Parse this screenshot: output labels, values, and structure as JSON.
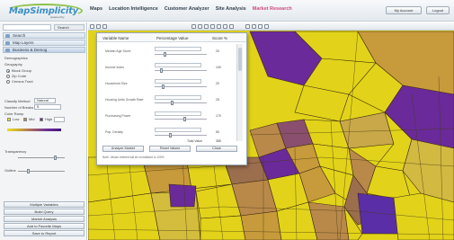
{
  "app": {
    "logo_text": "MapSimplicity",
    "logo_sub": "powered by"
  },
  "top_menu": [
    {
      "label": "Maps"
    },
    {
      "label": "Location Intelligence"
    },
    {
      "label": "Customer Analyzer"
    },
    {
      "label": "Site Analysis"
    },
    {
      "label": "Market Research",
      "active": true
    }
  ],
  "header_buttons": [
    {
      "label": "My Account"
    },
    {
      "label": "Logout"
    }
  ],
  "sidebar": {
    "search_button": "Search",
    "tabs": [
      {
        "label": "Search"
      },
      {
        "label": "Map Layers"
      },
      {
        "label": "Business & Demog"
      }
    ],
    "section_label": "Demographics",
    "geography_label": "Geography",
    "radio_options": [
      {
        "label": "Block Group",
        "selected": true
      },
      {
        "label": "Zip Code",
        "selected": false
      },
      {
        "label": "Census Tract",
        "selected": false
      }
    ],
    "classify_label": "Classify Method",
    "classify_value": "Natural",
    "breaks_label": "Number of Breaks",
    "breaks_value": "5",
    "color_label": "Color Ramp",
    "legend_labels": [
      "Low",
      "Mid",
      "High"
    ],
    "transparency_label": "Transparency",
    "outline_label": "Outline",
    "buttons": [
      {
        "label": "Multiple Variables"
      },
      {
        "label": "Build Query"
      },
      {
        "label": "Market Analysis"
      },
      {
        "label": "Add to Favorite Maps"
      },
      {
        "label": "Save to Report"
      }
    ]
  },
  "dialog": {
    "headers": [
      "Variable Name",
      "Percentage Value",
      "Score %"
    ],
    "rows": [
      {
        "label": "Median Age Score",
        "value": "20"
      },
      {
        "label": "Income Index",
        "value": "100"
      },
      {
        "label": "Household Size",
        "value": "20"
      },
      {
        "label": "Housing Units Growth Rate",
        "value": "25"
      },
      {
        "label": "Purchasing Power",
        "value": "170"
      },
      {
        "label": "Pop. Density",
        "value": "50"
      }
    ],
    "total_label": "Total Value",
    "total_value": "385",
    "buttons": [
      {
        "label": "Analyze Market"
      },
      {
        "label": "Reset Values"
      },
      {
        "label": "Close"
      }
    ],
    "note": "Note: Values entered will be normalized to 100%"
  },
  "colors": {
    "map_yellow": "#e2d31a",
    "map_purple": "#6a2a99",
    "map_brown": "#b9894a",
    "accent": "#3b8fc4"
  }
}
